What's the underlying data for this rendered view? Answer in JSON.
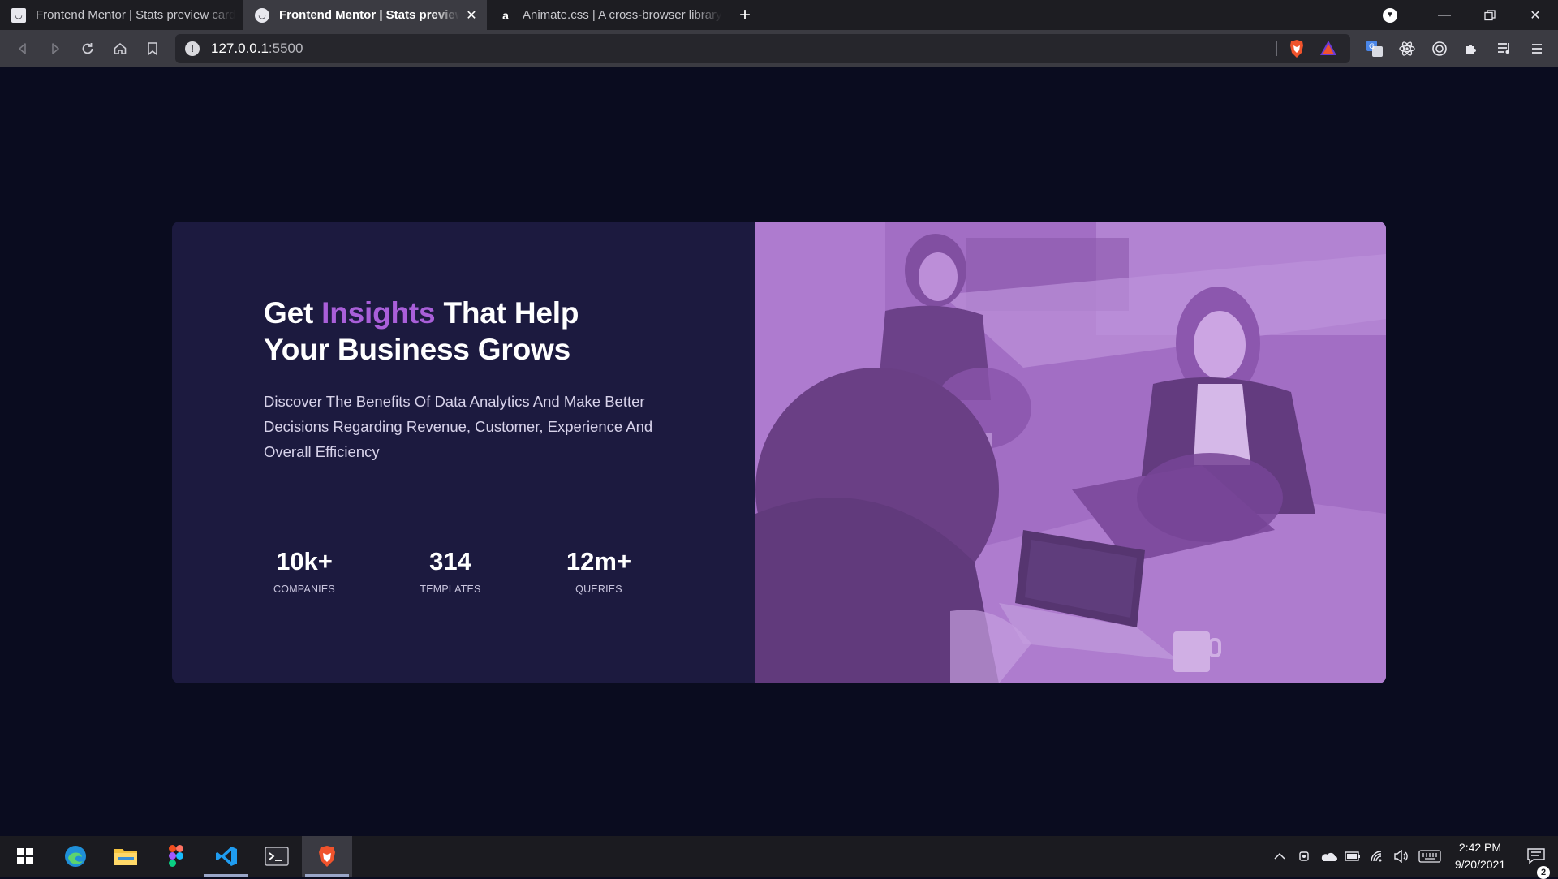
{
  "browser": {
    "tabs": [
      {
        "title": "Frontend Mentor | Stats preview card component",
        "active": false,
        "favicon": "frontend-mentor-favicon"
      },
      {
        "title": "Frontend Mentor | Stats preview card component",
        "active": true,
        "favicon": "frontend-mentor-favicon"
      },
      {
        "title": "Animate.css | A cross-browser library of CSS animations",
        "active": false,
        "favicon": "a"
      }
    ],
    "new_tab": "+",
    "url_host": "127.0.0.1",
    "url_port": ":5500"
  },
  "card": {
    "headline_pre": "Get ",
    "headline_accent": "Insights",
    "headline_post": " That Help",
    "headline_line2": "Your Business Grows",
    "description": "Discover The Benefits Of Data Analytics And Make Better Decisions Regarding Revenue, Customer, Experience And Overall Efficiency",
    "stats": [
      {
        "value": "10k+",
        "label": "COMPANIES"
      },
      {
        "value": "314",
        "label": "TEMPLATES"
      },
      {
        "value": "12m+",
        "label": "QUERIES"
      }
    ],
    "colors": {
      "background": "#1c1a3f",
      "accent": "#a95fd9",
      "page": "#0a0c1f",
      "image_tint": "#a66ecb"
    }
  },
  "taskbar": {
    "time": "2:42 PM",
    "date": "9/20/2021",
    "notification_count": "2"
  }
}
